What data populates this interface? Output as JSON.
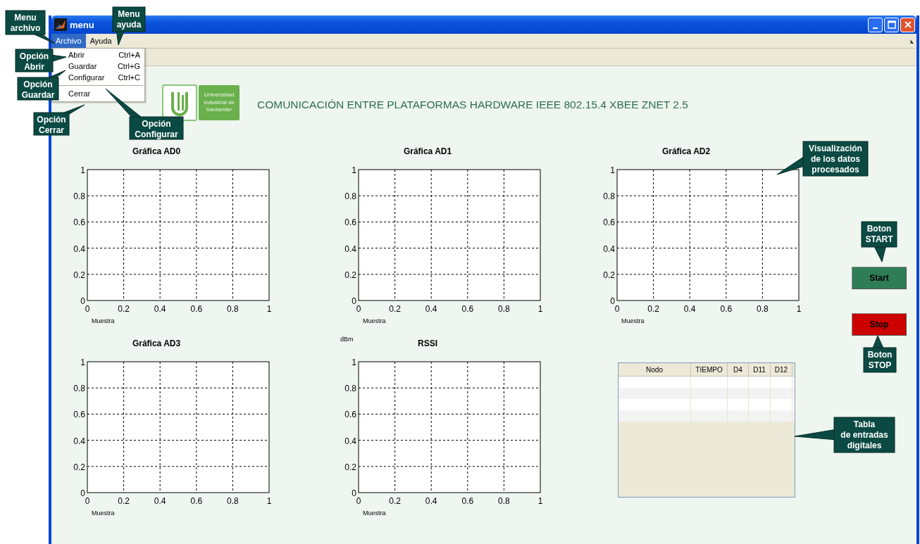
{
  "window": {
    "title": "menu"
  },
  "menubar": [
    {
      "label": "Archivo",
      "selected": true
    },
    {
      "label": "Ayuda",
      "selected": false
    }
  ],
  "dropdown": {
    "items": [
      {
        "label": "Abrir",
        "shortcut": "Ctrl+A",
        "separator_after": false
      },
      {
        "label": "Guardar",
        "shortcut": "Ctrl+G",
        "separator_after": false
      },
      {
        "label": "Configurar",
        "shortcut": "Ctrl+C",
        "separator_after": true
      },
      {
        "label": "Cerrar",
        "separator_after": false
      }
    ]
  },
  "logo": {
    "lines": [
      "Universidad",
      "Industrial de",
      "Santander"
    ]
  },
  "heading": "COMUNICACIÓN ENTRE PLATAFORMAS HARDWARE  IEEE 802.15.4 XBEE ZNET 2.5",
  "charts": [
    {
      "chart_data": {
        "type": "line",
        "grid": true,
        "title": "Gráfica AD0",
        "xlabel": "Muestra",
        "xlim": [
          0,
          1
        ],
        "ylim": [
          0,
          1
        ],
        "xticks": [
          0,
          0.2,
          0.4,
          0.6,
          0.8,
          1
        ],
        "yticks": [
          0,
          0.2,
          0.4,
          0.6,
          0.8,
          1
        ]
      }
    },
    {
      "chart_data": {
        "type": "line",
        "grid": true,
        "title": "Gráfica AD1",
        "xlabel": "Muestra",
        "xlim": [
          0,
          1
        ],
        "ylim": [
          0,
          1
        ],
        "xticks": [
          0,
          0.2,
          0.4,
          0.6,
          0.8,
          1
        ],
        "yticks": [
          0,
          0.2,
          0.4,
          0.6,
          0.8,
          1
        ]
      }
    },
    {
      "chart_data": {
        "type": "line",
        "grid": true,
        "title": "Gráfica AD2",
        "xlabel": "Muestra",
        "xlim": [
          0,
          1
        ],
        "ylim": [
          0,
          1
        ],
        "xticks": [
          0,
          0.2,
          0.4,
          0.6,
          0.8,
          1
        ],
        "yticks": [
          0,
          0.2,
          0.4,
          0.6,
          0.8,
          1
        ]
      }
    },
    {
      "chart_data": {
        "type": "line",
        "grid": true,
        "title": "Gráfica AD3",
        "xlabel": "Muestra",
        "xlim": [
          0,
          1
        ],
        "ylim": [
          0,
          1
        ],
        "xticks": [
          0,
          0.2,
          0.4,
          0.6,
          0.8,
          1
        ],
        "yticks": [
          0,
          0.2,
          0.4,
          0.6,
          0.8,
          1
        ]
      }
    },
    {
      "chart_data": {
        "type": "line",
        "grid": true,
        "title": "RSSI",
        "xlabel": "Muestra",
        "ylabel": "dBm",
        "xlim": [
          0,
          1
        ],
        "ylim": [
          0,
          1
        ],
        "xticks": [
          0,
          0.2,
          0.4,
          0.6,
          0.8,
          1
        ],
        "yticks": [
          0,
          0.2,
          0.4,
          0.6,
          0.8,
          1
        ]
      }
    }
  ],
  "buttons": [
    {
      "label": "Start",
      "color": "#2e7d57"
    },
    {
      "label": "Stop",
      "color": "#cc0000"
    }
  ],
  "table": {
    "columns": [
      "Nodo",
      "TIEMPO",
      "D4",
      "D11",
      "D12"
    ]
  },
  "callouts": [
    {
      "lines": [
        "Menu",
        "archivo"
      ]
    },
    {
      "lines": [
        "Menu",
        "ayuda"
      ]
    },
    {
      "lines": [
        "Opción",
        "Abrir"
      ]
    },
    {
      "lines": [
        "Opción",
        "Guardar"
      ]
    },
    {
      "lines": [
        "Opción",
        "Cerrar"
      ]
    },
    {
      "lines": [
        "Opción",
        "Configurar"
      ]
    },
    {
      "lines": [
        "Visualización",
        "de los datos",
        "procesados"
      ]
    },
    {
      "lines": [
        "Boton",
        "START"
      ]
    },
    {
      "lines": [
        "Boton",
        "STOP"
      ]
    },
    {
      "lines": [
        "Tabla",
        "de entradas",
        "digitales"
      ]
    }
  ]
}
